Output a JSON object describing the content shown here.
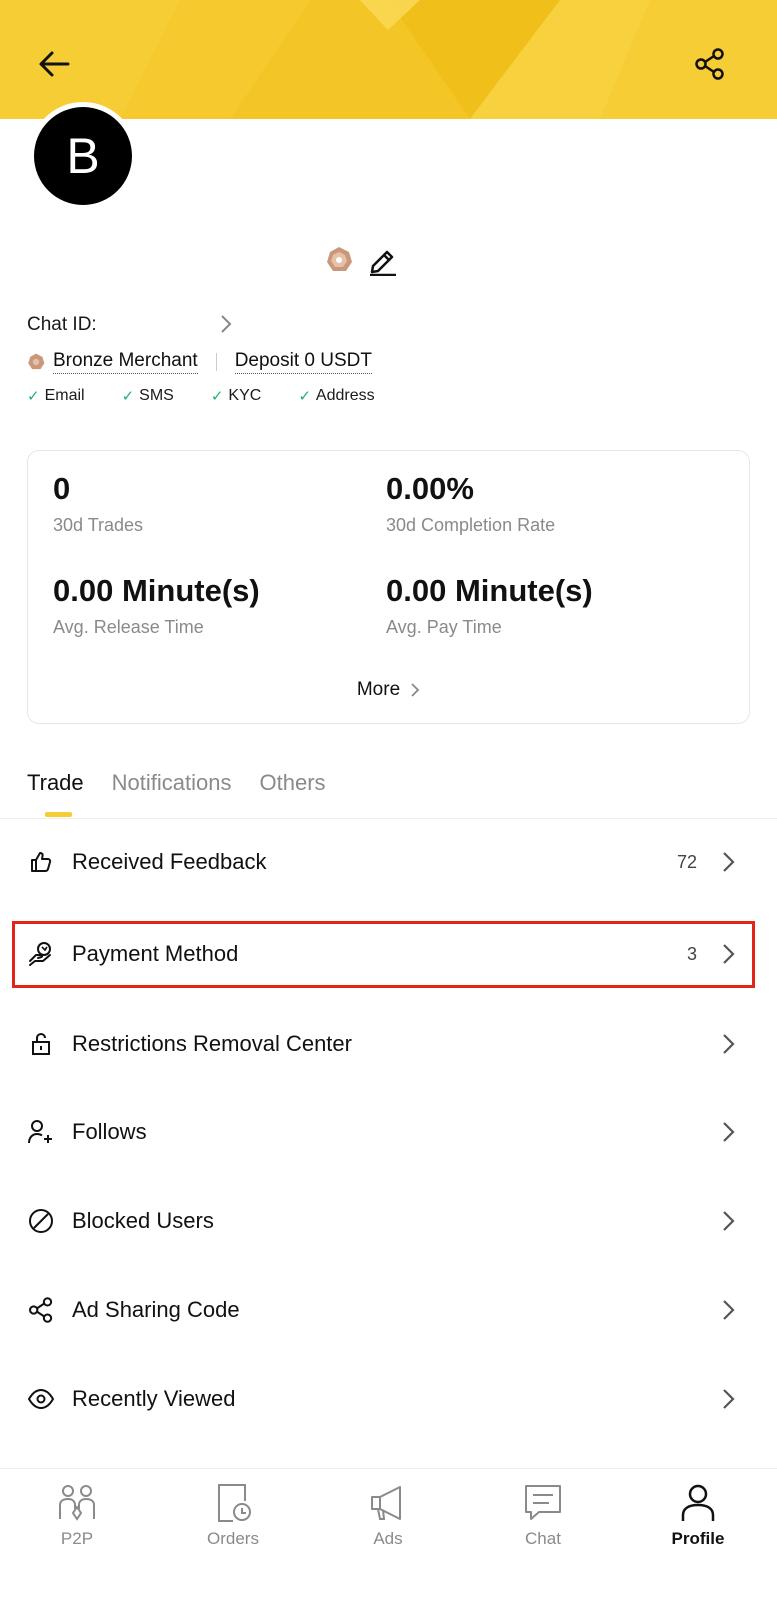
{
  "header": {
    "back_icon": "arrow-left-icon",
    "share_icon": "share-icon",
    "banner_color": "#f7cd36"
  },
  "profile": {
    "avatar_letter": "B",
    "chat_id_label": "Chat ID:",
    "merchant_level": "Bronze Merchant",
    "deposit": "Deposit 0 USDT",
    "verifications": [
      "Email",
      "SMS",
      "KYC",
      "Address"
    ]
  },
  "stats": {
    "trades_value": "0",
    "trades_label": "30d Trades",
    "completion_value": "0.00%",
    "completion_label": "30d Completion Rate",
    "release_value": "0.00 Minute(s)",
    "release_label": "Avg. Release Time",
    "pay_value": "0.00 Minute(s)",
    "pay_label": "Avg. Pay Time",
    "more_label": "More"
  },
  "tabs": [
    {
      "label": "Trade",
      "active": true
    },
    {
      "label": "Notifications",
      "active": false
    },
    {
      "label": "Others",
      "active": false
    }
  ],
  "list": [
    {
      "label": "Received Feedback",
      "count": "72",
      "icon": "thumbs-up-icon"
    },
    {
      "label": "Payment Method",
      "count": "3",
      "icon": "payment-hand-icon"
    },
    {
      "label": "Restrictions Removal Center",
      "count": "",
      "icon": "unlock-icon"
    },
    {
      "label": "Follows",
      "count": "",
      "icon": "user-plus-icon"
    },
    {
      "label": "Blocked Users",
      "count": "",
      "icon": "blocked-icon"
    },
    {
      "label": "Ad Sharing Code",
      "count": "",
      "icon": "share-icon"
    },
    {
      "label": "Recently Viewed",
      "count": "",
      "icon": "eye-icon"
    }
  ],
  "bottom_nav": [
    {
      "label": "P2P",
      "icon": "p2p-users-icon",
      "active": false
    },
    {
      "label": "Orders",
      "icon": "orders-icon",
      "active": false
    },
    {
      "label": "Ads",
      "icon": "megaphone-icon",
      "active": false
    },
    {
      "label": "Chat",
      "icon": "chat-icon",
      "active": false
    },
    {
      "label": "Profile",
      "icon": "profile-icon",
      "active": true
    }
  ],
  "colors": {
    "accent": "#f7cd36",
    "check": "#20b26c",
    "highlight_border": "#e3241b"
  }
}
